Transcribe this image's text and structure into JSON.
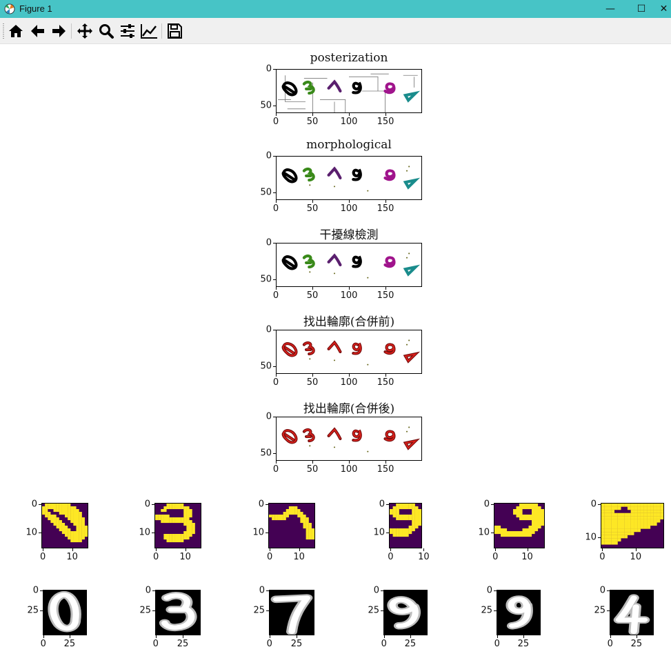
{
  "window": {
    "title": "Figure 1",
    "minimize_glyph": "—",
    "maximize_glyph": "☐",
    "close_glyph": "✕",
    "accent": "#47c4c6"
  },
  "toolbar": {
    "buttons": [
      {
        "name": "home-icon"
      },
      {
        "name": "back-arrow-icon"
      },
      {
        "name": "forward-arrow-icon"
      },
      {
        "name": "pan-move-icon"
      },
      {
        "name": "zoom-magnifier-icon"
      },
      {
        "name": "subplots-sliders-icon"
      },
      {
        "name": "edit-axis-line-icon"
      },
      {
        "name": "save-floppy-icon"
      }
    ]
  },
  "chart_data": [
    {
      "type": "image",
      "title": "posterization",
      "xticks": [
        "0",
        "50",
        "100",
        "150"
      ],
      "yticks": [
        "0",
        "50"
      ],
      "xlim": [
        0,
        200
      ],
      "ylim": [
        60,
        0
      ],
      "content": "white canvas with colored digit strokes 0,3,7,9,9,4 and thin grey interference lines"
    },
    {
      "type": "image",
      "title": "morphological",
      "xticks": [
        "0",
        "50",
        "100",
        "150"
      ],
      "yticks": [
        "0",
        "50"
      ],
      "xlim": [
        0,
        200
      ],
      "ylim": [
        60,
        0
      ],
      "content": "digits 0,3,7,9,9,4 after morphological cleaning"
    },
    {
      "type": "image",
      "title": "干擾線檢測",
      "xticks": [
        "0",
        "50",
        "100",
        "150"
      ],
      "yticks": [
        "0",
        "50"
      ],
      "xlim": [
        0,
        200
      ],
      "ylim": [
        60,
        0
      ],
      "content": "digits after interference line detection"
    },
    {
      "type": "image",
      "title": "找出輪廓(合併前)",
      "xticks": [
        "0",
        "50",
        "100",
        "150"
      ],
      "yticks": [
        "0",
        "50"
      ],
      "xlim": [
        0,
        200
      ],
      "ylim": [
        60,
        0
      ],
      "content": "digits with red contours before merging"
    },
    {
      "type": "image",
      "title": "找出輪廓(合併後)",
      "xticks": [
        "0",
        "50",
        "100",
        "150"
      ],
      "yticks": [
        "0",
        "50"
      ],
      "xlim": [
        0,
        200
      ],
      "ylim": [
        60,
        0
      ],
      "content": "digits with red contours after merging"
    },
    {
      "type": "heatmap",
      "title": "",
      "content": "yellow digit 0 on purple",
      "xticks": [
        "0",
        "10"
      ],
      "yticks": [
        "0",
        "10"
      ]
    },
    {
      "type": "heatmap",
      "title": "",
      "content": "yellow digit 3 on purple",
      "xticks": [
        "0",
        "10"
      ],
      "yticks": [
        "0",
        "10"
      ]
    },
    {
      "type": "heatmap",
      "title": "",
      "content": "yellow digit 7 on purple",
      "xticks": [
        "0",
        "10"
      ],
      "yticks": [
        "0",
        "10"
      ]
    },
    {
      "type": "heatmap",
      "title": "",
      "content": "yellow digit 9 on purple",
      "xticks": [
        "0",
        "10"
      ],
      "yticks": [
        "0",
        "10"
      ]
    },
    {
      "type": "heatmap",
      "title": "",
      "content": "yellow digit 9 on purple",
      "xticks": [
        "0",
        "10"
      ],
      "yticks": [
        "0",
        "10"
      ]
    },
    {
      "type": "heatmap",
      "title": "",
      "content": "yellow digit 4 on purple",
      "xticks": [
        "0",
        "10"
      ],
      "yticks": [
        "0",
        "10"
      ]
    },
    {
      "type": "image",
      "title": "",
      "content": "grayscale digit 0",
      "xticks": [
        "0",
        "25"
      ],
      "yticks": [
        "0",
        "25"
      ]
    },
    {
      "type": "image",
      "title": "",
      "content": "grayscale digit 3",
      "xticks": [
        "0",
        "25"
      ],
      "yticks": [
        "0",
        "25"
      ]
    },
    {
      "type": "image",
      "title": "",
      "content": "grayscale digit 7",
      "xticks": [
        "0",
        "25"
      ],
      "yticks": [
        "0",
        "25"
      ]
    },
    {
      "type": "image",
      "title": "",
      "content": "grayscale digit 9",
      "xticks": [
        "0",
        "25"
      ],
      "yticks": [
        "0",
        "25"
      ]
    },
    {
      "type": "image",
      "title": "",
      "content": "grayscale digit 9",
      "xticks": [
        "0",
        "25"
      ],
      "yticks": [
        "0",
        "25"
      ]
    },
    {
      "type": "image",
      "title": "",
      "content": "grayscale digit 4",
      "xticks": [
        "0",
        "25"
      ],
      "yticks": [
        "0",
        "25"
      ]
    }
  ],
  "colors": {
    "viridis_low": "#440154",
    "viridis_high": "#fde725",
    "contour": "#e0201a",
    "digit_green": "#3a8a1a",
    "digit_magenta": "#a0148c",
    "digit_teal": "#1a8c8c"
  }
}
